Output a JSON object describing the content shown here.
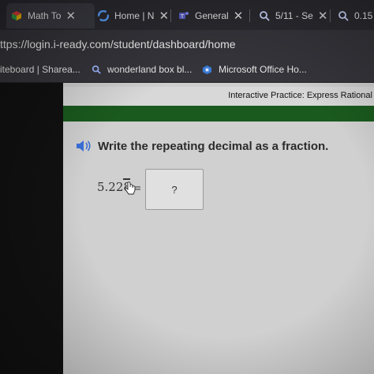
{
  "browser": {
    "tabs": [
      {
        "label": "Math To",
        "favicon": "colorful-cube-icon",
        "active": true
      },
      {
        "label": "Home | N",
        "favicon": "blue-swirl-icon",
        "active": false
      },
      {
        "label": "General",
        "favicon": "teams-icon",
        "active": false
      },
      {
        "label": "5/11 - Se",
        "favicon": "search-icon",
        "active": false
      },
      {
        "label": "0.15",
        "favicon": "search-icon",
        "active": false
      }
    ],
    "url": "ttps://login.i-ready.com/student/dashboard/home",
    "bookmarks": [
      {
        "label": "iteboard | Sharea...",
        "icon": ""
      },
      {
        "label": "wonderland box bl...",
        "icon": "search-icon"
      },
      {
        "label": "Microsoft Office Ho...",
        "icon": "office-icon"
      }
    ]
  },
  "lesson": {
    "header_title": "Interactive Practice: Express Rational",
    "question": "Write the repeating decimal as a fraction.",
    "decimal_value": "5.228",
    "repeating_digit": "8",
    "equals": "=",
    "answer_placeholder": "?"
  },
  "colors": {
    "green_bar": "#1a5a1e",
    "content_bg": "#cfcfcf",
    "tabstrip_bg": "#2a2a30",
    "speaker_blue": "#3a6fd8"
  }
}
